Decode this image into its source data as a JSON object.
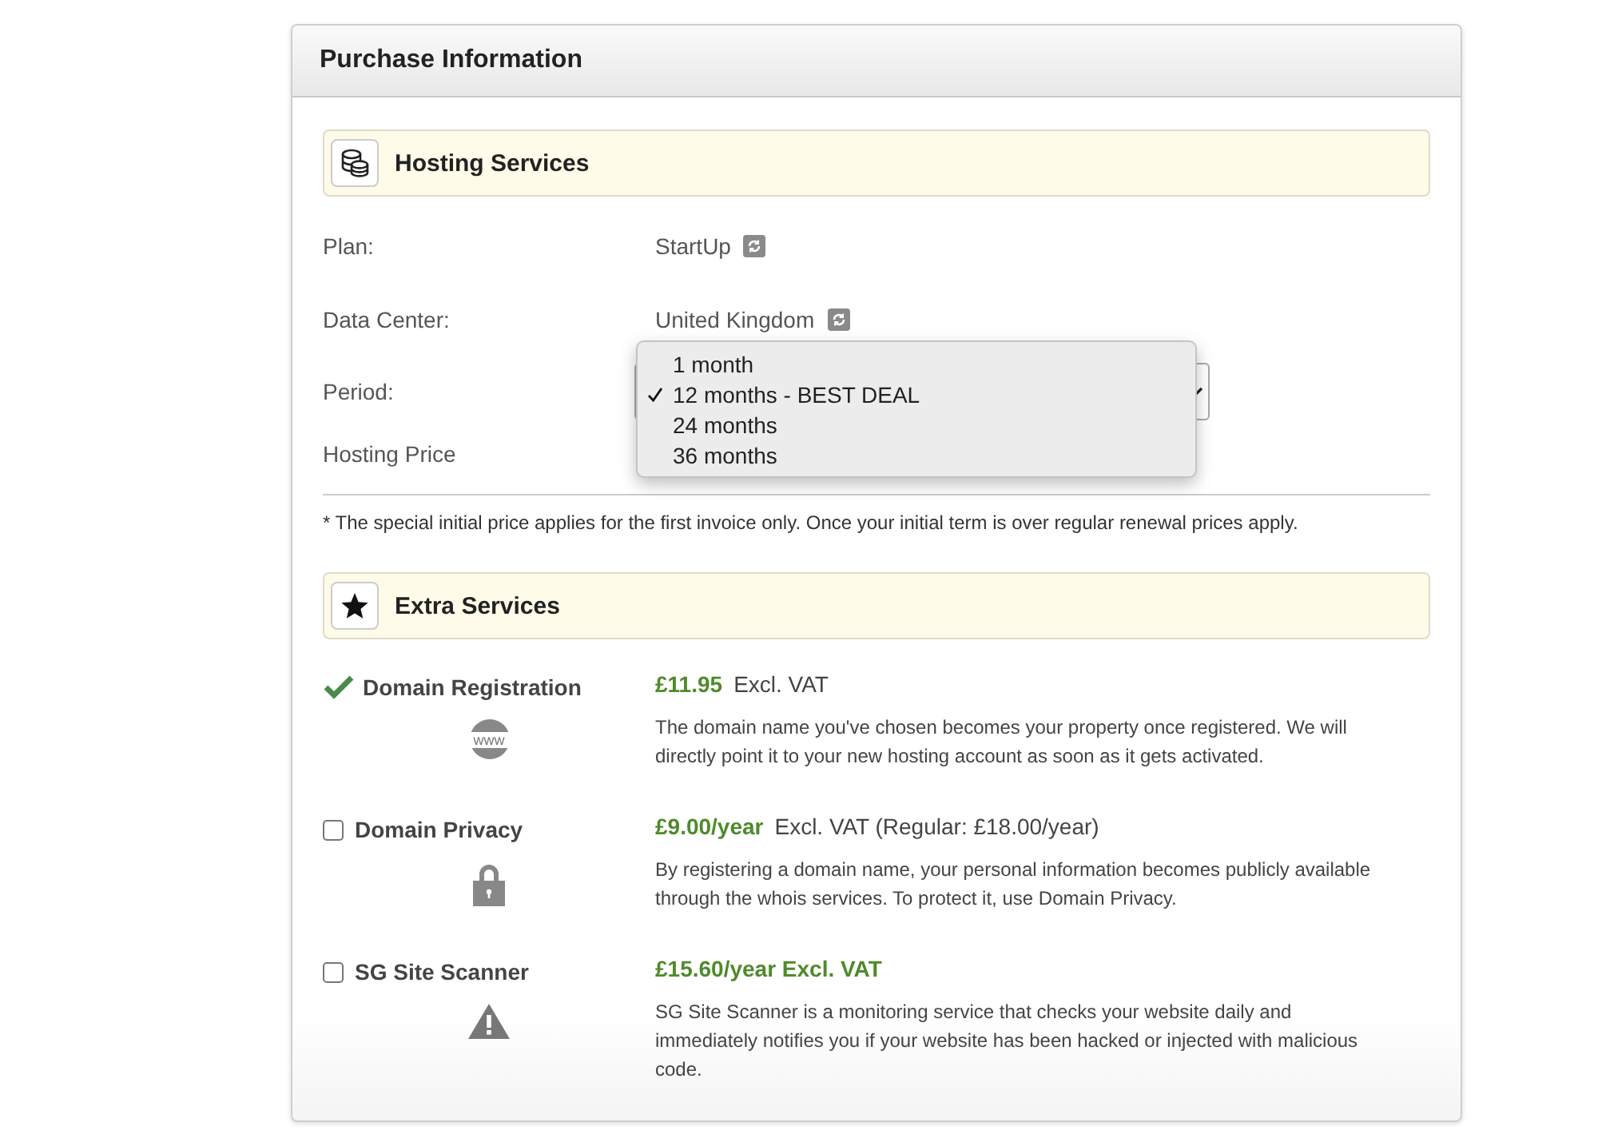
{
  "panel": {
    "title": "Purchase Information"
  },
  "hosting": {
    "title": "Hosting Services",
    "rows": [
      {
        "label": "Plan:",
        "value": "StartUp",
        "kind": "change"
      },
      {
        "label": "Data Center:",
        "value": "United Kingdom",
        "kind": "change"
      },
      {
        "label": "Period:",
        "kind": "select",
        "options": [
          {
            "label": "1 month",
            "selected": false
          },
          {
            "label": "12 months - BEST DEAL",
            "selected": true
          },
          {
            "label": "24 months",
            "selected": false
          },
          {
            "label": "36 months",
            "selected": false
          }
        ]
      },
      {
        "label": "Hosting Price",
        "kind": "hidden"
      }
    ],
    "note": "* The special initial price applies for the first invoice only. Once your initial term is over regular renewal prices apply."
  },
  "extras": {
    "title": "Extra Services",
    "items": [
      {
        "name": "Domain Registration",
        "checked": true,
        "kind": "www",
        "icon_text": "www",
        "price": "£11.95",
        "price_note": "Excl. VAT",
        "description": "The domain name you've chosen becomes your property once registered. We will directly point it to your new hosting account as soon as it gets activated."
      },
      {
        "name": "Domain Privacy",
        "checked": false,
        "kind": "lock",
        "price": "£9.00/year",
        "price_note": "Excl. VAT (Regular: £18.00/year)",
        "description": "By registering a domain name, your personal information becomes publicly available through the whois services. To protect it, use Domain Privacy."
      },
      {
        "name": "SG Site Scanner",
        "checked": false,
        "kind": "warning",
        "price": "£15.60/year Excl. VAT",
        "description": "SG Site Scanner is a monitoring service that checks your website daily and immediately notifies you if your website has been hacked or injected with malicious code."
      }
    ]
  }
}
